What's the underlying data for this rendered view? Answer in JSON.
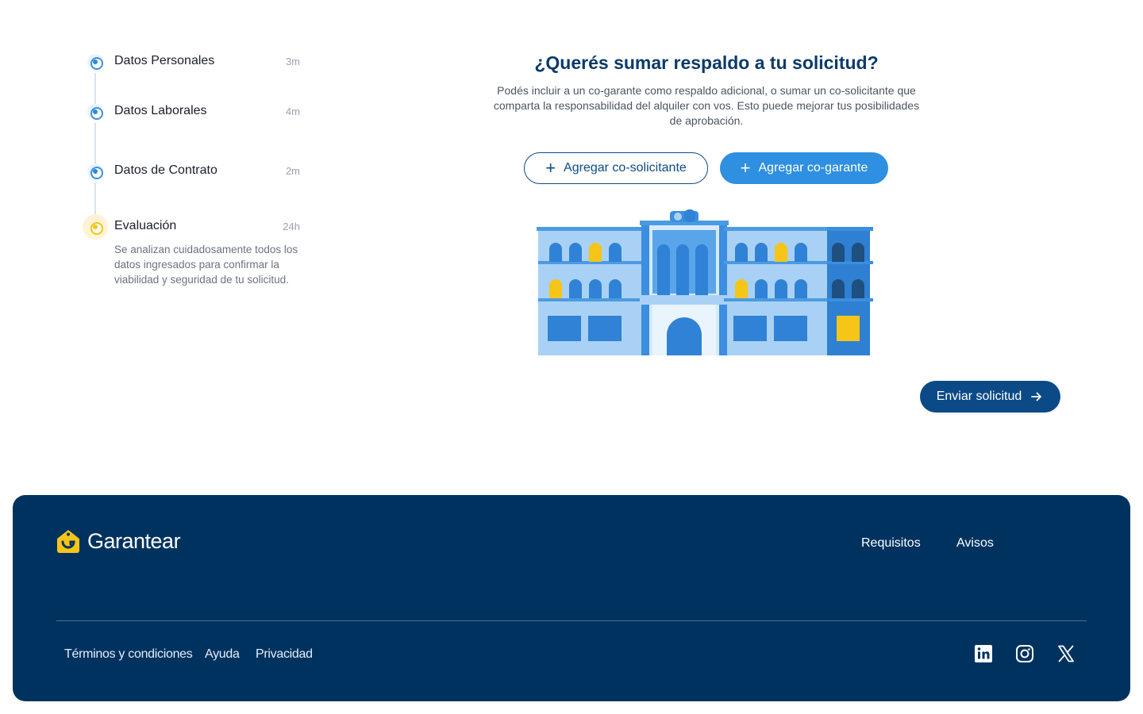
{
  "stepper": {
    "steps": [
      {
        "title": "Datos Personales",
        "time": "3m",
        "state": "completed"
      },
      {
        "title": "Datos Laborales",
        "time": "4m",
        "state": "completed"
      },
      {
        "title": "Datos de Contrato",
        "time": "2m",
        "state": "completed"
      },
      {
        "title": "Evaluación",
        "time": "24h",
        "state": "pending",
        "description": "Se analizan cuidadosamente todos los datos ingresados para confirmar la viabilidad y seguridad de tu solicitud."
      }
    ]
  },
  "main": {
    "headline": "¿Querés sumar respaldo a tu solicitud?",
    "subtext": "Podés incluir a un co-garante como respaldo adicional, o sumar un co-solicitante que comparta la responsabilidad del alquiler con vos. Esto puede mejorar tus posibilidades de aprobación.",
    "add_cosolicitante_label": "Agregar co-solicitante",
    "add_cogarante_label": "Agregar co-garante",
    "submit_label": "Enviar solicitud",
    "illustration": "building-illustration"
  },
  "footer": {
    "brand": "Garantear",
    "nav": [
      "Requisitos",
      "Avisos"
    ],
    "legal": [
      "Términos y condiciones",
      "Ayuda",
      "Privacidad"
    ],
    "social": [
      "linkedin-icon",
      "instagram-icon",
      "x-icon"
    ]
  },
  "colors": {
    "primary": "#0c4a87",
    "accent": "#2f8fe0",
    "footer_bg": "#003260",
    "highlight": "#f5c518"
  }
}
